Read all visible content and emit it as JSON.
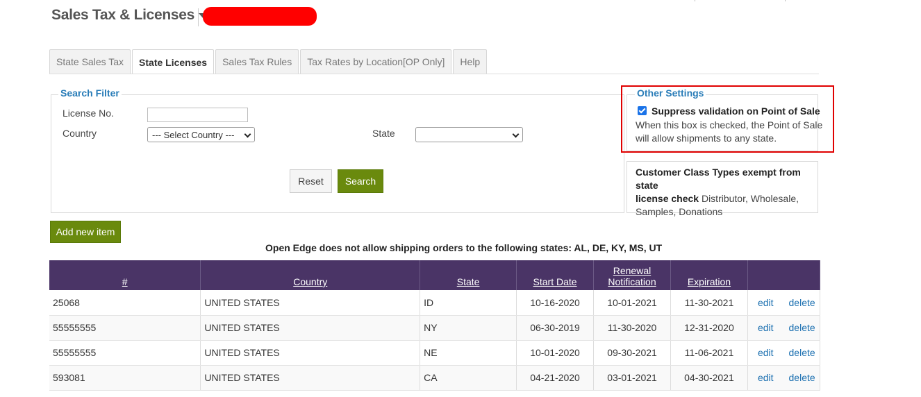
{
  "header": {
    "title": "Sales Tax & Licenses"
  },
  "tabs": [
    {
      "label": "State Sales Tax",
      "active": false
    },
    {
      "label": "State Licenses",
      "active": true
    },
    {
      "label": "Sales Tax Rules",
      "active": false
    },
    {
      "label": "Tax Rates by Location[OP Only]",
      "active": false
    },
    {
      "label": "Help",
      "active": false
    }
  ],
  "search_filter": {
    "legend": "Search Filter",
    "license_label": "License No.",
    "license_value": "",
    "country_label": "Country",
    "country_selected": "--- Select Country ---",
    "state_label": "State",
    "state_selected": "",
    "reset_label": "Reset",
    "search_label": "Search"
  },
  "other_settings": {
    "legend": "Other Settings",
    "suppress_label": "Suppress validation on Point of Sale",
    "suppress_checked": true,
    "suppress_desc_1": "When this box is checked, the Point of Sale",
    "suppress_desc_2": "will allow shipments to any state.",
    "exempt_bold_1": "Customer Class Types exempt from state",
    "exempt_bold_2": "license check",
    "exempt_list_1": " Distributor, Wholesale,",
    "exempt_list_2": "Samples, Donations"
  },
  "add_button_label": "Add new item",
  "notice": "Open Edge does not allow shipping orders to the following states: AL, DE, KY, MS, UT",
  "table": {
    "headers": {
      "num": "#",
      "country": "Country",
      "state": "State",
      "start": "Start Date",
      "renewal_1": "Renewal",
      "renewal_2": "Notification",
      "expiration": "Expiration"
    },
    "edit_label": "edit",
    "delete_label": "delete",
    "rows": [
      {
        "num": "25068",
        "country": "UNITED STATES",
        "state": "ID",
        "start": "10-16-2020",
        "renewal": "10-01-2021",
        "expiration": "11-30-2021"
      },
      {
        "num": "55555555",
        "country": "UNITED STATES",
        "state": "NY",
        "start": "06-30-2019",
        "renewal": "11-30-2020",
        "expiration": "12-31-2020"
      },
      {
        "num": "55555555",
        "country": "UNITED STATES",
        "state": "NE",
        "start": "10-01-2020",
        "renewal": "09-30-2021",
        "expiration": "11-06-2021"
      },
      {
        "num": "593081",
        "country": "UNITED STATES",
        "state": "CA",
        "start": "04-21-2020",
        "renewal": "03-01-2021",
        "expiration": "04-30-2021"
      }
    ]
  },
  "colors": {
    "accent_blue": "#2a7db8",
    "header_purple": "#4a3466",
    "button_green": "#6a8a0d",
    "highlight_red": "#e00000",
    "redacted_red": "#ff0000"
  }
}
